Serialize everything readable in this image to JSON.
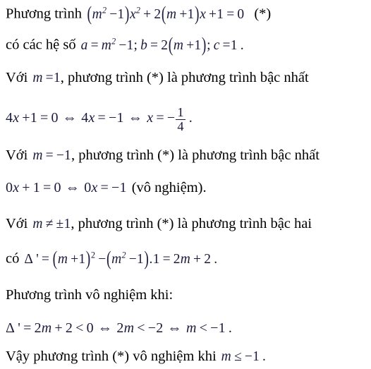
{
  "document": {
    "type": "math-solution",
    "language": "vi",
    "background_color": "#ffffff",
    "prose_color": "#000000",
    "math_color": "#1a1a3c",
    "lines": [
      {
        "id": "line-1",
        "prose_prefix": "Phương trình",
        "math": "(m² −1)x² + 2(m +1)x +1 = 0",
        "prose_suffix": "(*)",
        "full_text": "Phương trình (m² −1)x² + 2(m +1)x +1 = 0  (*)"
      },
      {
        "id": "line-2",
        "prose_prefix": "có các hệ số",
        "math": "a = m² −1; b = 2(m +1); c =1 .",
        "prose_suffix": "",
        "full_text": "có các hệ số a = m² −1; b = 2(m +1); c =1 ."
      },
      {
        "id": "line-3",
        "prose_prefix": "Với",
        "math": "m =1",
        "prose_suffix": ", phương trình (*) là phương trình bậc nhất",
        "full_text": "Với m =1, phương trình (*) là phương trình bậc nhất"
      },
      {
        "id": "line-4",
        "prose_prefix": "",
        "math": "4x +1 = 0 ⇔ 4x = −1 ⇔ x = − 1/4 .",
        "prose_suffix": "",
        "full_text": "4x +1 = 0 ⇔ 4x = −1 ⇔ x = − 1/4 ."
      },
      {
        "id": "line-5",
        "prose_prefix": "Với",
        "math": "m = −1",
        "prose_suffix": ", phương trình (*) là phương trình bậc nhất",
        "full_text": "Với m = −1, phương trình (*) là phương trình bậc nhất"
      },
      {
        "id": "line-6",
        "prose_prefix": "",
        "math": "0x +1 = 0 ⇔ 0x = −1",
        "prose_suffix": "(vô nghiệm).",
        "full_text": "0x +1 = 0 ⇔ 0x = −1 (vô nghiệm)."
      },
      {
        "id": "line-7",
        "prose_prefix": "Với",
        "math": "m ≠ ±1",
        "prose_suffix": ", phương trình (*) là phương trình bậc hai",
        "full_text": "Với m ≠ ±1, phương trình (*) là phương trình bậc hai"
      },
      {
        "id": "line-8",
        "prose_prefix": "có",
        "math": "Δ ' = (m +1)² − (m² −1).1 = 2m + 2 .",
        "prose_suffix": "",
        "full_text": "có Δ ' = (m +1)² − (m² −1).1 = 2m + 2 ."
      },
      {
        "id": "line-9",
        "prose_prefix": "Phương trình vô nghiệm khi:",
        "math": "",
        "prose_suffix": "",
        "full_text": "Phương trình vô nghiệm khi:"
      },
      {
        "id": "line-10",
        "prose_prefix": "",
        "math": "Δ ' = 2m + 2 < 0 ⇔ 2m < −2 ⇔ m < −1 .",
        "prose_suffix": "",
        "full_text": "Δ ' = 2m + 2 < 0 ⇔ 2m < −2 ⇔ m < −1 ."
      },
      {
        "id": "line-11",
        "prose_prefix": "Vậy phương trình (*) vô nghiệm khi",
        "math": "m ≤ −1 .",
        "prose_suffix": "",
        "full_text": "Vậy phương trình (*) vô nghiệm khi m ≤ −1 ."
      }
    ]
  },
  "tokens": {
    "phuong_trinh": "Phương trình",
    "co_cac_he_so": "có các hệ số",
    "voi": "Với",
    "la_pt_bac_nhat": ", phương trình (*) là phương trình bậc nhất",
    "la_pt_bac_hai": ", phương trình (*) là phương trình bậc hai",
    "co": "có",
    "vo_nghiem_paren": "(vô nghiệm).",
    "pt_vo_nghiem_khi": "Phương trình vô nghiệm khi:",
    "vay_pt": "Vậy phương trình (*) vô nghiệm khi",
    "star": "(*)",
    "m": "m",
    "x": "x",
    "a": "a",
    "b": "b",
    "c": "c",
    "delta_prime": "Δ '",
    "eq": "=",
    "plus": "+",
    "minus": "−",
    "iff": "⇔",
    "lt": "<",
    "le": "≤",
    "ne": "≠",
    "pm": "±",
    "dot": ".",
    "semicolon": ";",
    "period": ".",
    "n0": "0",
    "n1": "1",
    "n2": "2",
    "n4": "4",
    "sup2": "2",
    "lparen": "(",
    "rparen": ")",
    "frac_num": "1",
    "frac_den": "4"
  }
}
